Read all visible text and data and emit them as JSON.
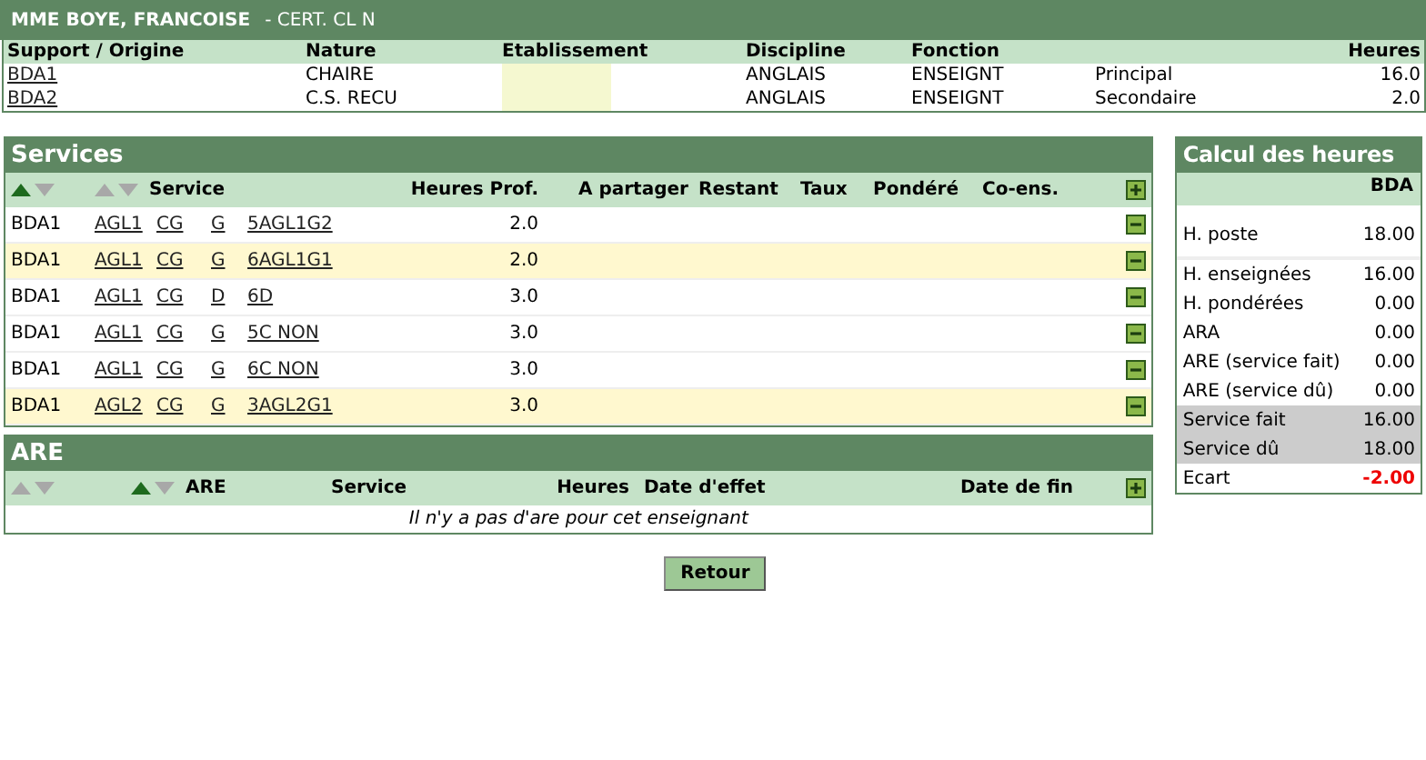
{
  "header": {
    "name": "MME BOYE, FRANCOISE",
    "grade": "- CERT. CL N"
  },
  "postes": {
    "columns": [
      "Support / Origine",
      "Nature",
      "Etablissement",
      "Discipline",
      "Fonction",
      "",
      "Heures"
    ],
    "rows": [
      {
        "support": "BDA1",
        "nature": "CHAIRE",
        "discipline": "ANGLAIS",
        "fonction": "ENSEIGNT",
        "type": "Principal",
        "heures": "16.0"
      },
      {
        "support": "BDA2",
        "nature": "C.S. RECU",
        "discipline": "ANGLAIS",
        "fonction": "ENSEIGNT",
        "type": "Secondaire",
        "heures": "2.0"
      }
    ]
  },
  "services": {
    "title": "Services",
    "sort_arrows": [
      {
        "up_active": true,
        "down_active": false
      },
      {
        "up_active": false,
        "down_active": false
      }
    ],
    "columns": [
      "Service",
      "Heures Prof.",
      "A partager",
      "Restant",
      "Taux",
      "Pondéré",
      "Co-ens."
    ],
    "rows": [
      {
        "support": "BDA1",
        "links": [
          "AGL1",
          "CG",
          "G",
          "5AGL1G2"
        ],
        "heures": "2.0",
        "highlighted": false
      },
      {
        "support": "BDA1",
        "links": [
          "AGL1",
          "CG",
          "G",
          "6AGL1G1"
        ],
        "heures": "2.0",
        "highlighted": true
      },
      {
        "support": "BDA1",
        "links": [
          "AGL1",
          "CG",
          "D",
          "6D"
        ],
        "heures": "3.0",
        "highlighted": false
      },
      {
        "support": "BDA1",
        "links": [
          "AGL1",
          "CG",
          "G",
          "5C NON"
        ],
        "heures": "3.0",
        "highlighted": false
      },
      {
        "support": "BDA1",
        "links": [
          "AGL1",
          "CG",
          "G",
          "6C NON"
        ],
        "heures": "3.0",
        "highlighted": false
      },
      {
        "support": "BDA1",
        "links": [
          "AGL2",
          "CG",
          "G",
          "3AGL2G1"
        ],
        "heures": "3.0",
        "highlighted": true
      }
    ]
  },
  "are": {
    "title": "ARE",
    "sort_arrows": [
      {
        "up_active": false,
        "down_active": false
      },
      {
        "up_active": true,
        "down_active": false
      }
    ],
    "columns": [
      "ARE",
      "Service",
      "Heures",
      "Date d'effet",
      "Date de fin"
    ],
    "empty_message": "Il n'y a pas d'are pour cet enseignant"
  },
  "button": "Retour",
  "calcul": {
    "title": "Calcul des heures",
    "column": "BDA",
    "rows": [
      {
        "label": "H. poste",
        "value": "18.00",
        "kind": "separated"
      },
      {
        "label": "H. enseignées",
        "value": "16.00",
        "kind": "normal"
      },
      {
        "label": "H. pondérées",
        "value": "0.00",
        "kind": "normal"
      },
      {
        "label": "ARA",
        "value": "0.00",
        "kind": "normal"
      },
      {
        "label": "ARE (service fait)",
        "value": "0.00",
        "kind": "normal"
      },
      {
        "label": "ARE (service dû)",
        "value": "0.00",
        "kind": "normal"
      },
      {
        "label": "Service fait",
        "value": "16.00",
        "kind": "shaded"
      },
      {
        "label": "Service dû",
        "value": "18.00",
        "kind": "shaded"
      },
      {
        "label": "Ecart",
        "value": "-2.00",
        "kind": "result"
      }
    ]
  }
}
